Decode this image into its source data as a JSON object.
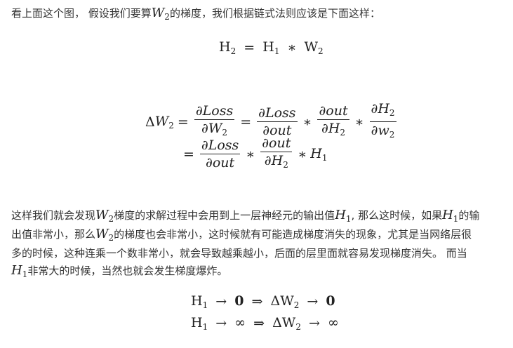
{
  "intro": {
    "prefix": "看上面这个图， 假设我们要算",
    "var": "W",
    "sub": "2",
    "suffix": "的梯度，我们根据链式法则应该是下面这样："
  },
  "eq1": {
    "lhs": "H",
    "lhs_sub": "2",
    "eq": "=",
    "a": "H",
    "a_sub": "1",
    "op": "∗",
    "b": "W",
    "b_sub": "2"
  },
  "eq2": {
    "delta": "Δ",
    "w": "W",
    "w_sub": "2",
    "eq": "=",
    "star": "∗",
    "loss_num": "∂Loss",
    "dw2_den": "∂W",
    "dw2_sub": "2",
    "dout_den": "∂out",
    "dout_num": "∂out",
    "dh2": "∂H",
    "dh2_sub": "2",
    "dw_small": "∂w",
    "dw_small_sub": "2",
    "h1": "H",
    "h1_sub": "1"
  },
  "para": {
    "l1_a": "这样我们就会发现",
    "l1_w": "W",
    "l1_w_sub": "2",
    "l1_b": "梯度的求解过程中会用到上一层神经元的输出值",
    "l1_h": "H",
    "l1_h_sub": "1",
    "l1_c": ", 那么这时候，如果",
    "l1_h2": "H",
    "l1_h2_sub": "1",
    "l1_d": "的输",
    "l2_a": "出值非常小，那么",
    "l2_w": "W",
    "l2_w_sub": "2",
    "l2_b": "的梯度也会非常小，这时候就有可能造成梯度消失的现象，尤其是当网络层很",
    "l3": "多的时候，这种连乘一个数非常小，就会导致越乘越小，后面的层里面就容易发现梯度消失。 而当",
    "l4_h": "H",
    "l4_h_sub": "1",
    "l4_b": "非常大的时候，当然也就会发生梯度爆炸。"
  },
  "eq3": {
    "h": "H",
    "h_sub": "1",
    "arrow": "→",
    "implies": "⇒",
    "dw": "ΔW",
    "dw_sub": "2",
    "zero": "0",
    "inf": "∞"
  }
}
